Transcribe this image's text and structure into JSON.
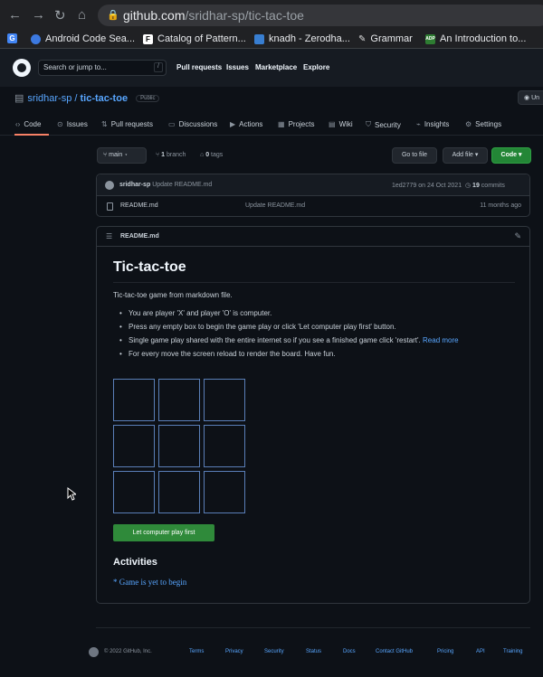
{
  "browser": {
    "url_host": "github.com",
    "url_path": "/sridhar-sp/tic-tac-toe",
    "bookmarks": [
      {
        "label": "Android Code Sea...",
        "icon": "android-icon",
        "color": "#3c79e0"
      },
      {
        "label": "Catalog of Pattern...",
        "icon": "f-icon",
        "color": "#ffffff"
      },
      {
        "label": "knadh - Zerodha...",
        "icon": "zerodha-icon",
        "color": "#387ed1"
      },
      {
        "label": "Grammar",
        "icon": "pen-icon",
        "color": "#dddddd"
      },
      {
        "label": "An Introduction to...",
        "icon": "adp-icon",
        "color": "#2e7d32"
      }
    ]
  },
  "header": {
    "search_placeholder": "Search or jump to...",
    "search_shortcut": "/",
    "nav": [
      "Pull requests",
      "Issues",
      "Marketplace",
      "Explore"
    ]
  },
  "repo": {
    "owner": "sridhar-sp",
    "separator": "/",
    "name": "tic-tac-toe",
    "visibility": "Public",
    "watch_label": "Un"
  },
  "tabs": [
    {
      "label": "Code",
      "icon": "code-icon"
    },
    {
      "label": "Issues",
      "icon": "issue-icon"
    },
    {
      "label": "Pull requests",
      "icon": "pull-request-icon"
    },
    {
      "label": "Discussions",
      "icon": "discussion-icon"
    },
    {
      "label": "Actions",
      "icon": "play-icon"
    },
    {
      "label": "Projects",
      "icon": "table-icon"
    },
    {
      "label": "Wiki",
      "icon": "book-icon"
    },
    {
      "label": "Security",
      "icon": "shield-icon"
    },
    {
      "label": "Insights",
      "icon": "graph-icon"
    },
    {
      "label": "Settings",
      "icon": "gear-icon"
    }
  ],
  "toolbar": {
    "branch": "main",
    "branch_count": "1",
    "branch_word": "branch",
    "tag_count": "0",
    "tag_word": "tags",
    "go_to_file": "Go to file",
    "add_file": "Add file",
    "code": "Code"
  },
  "commit": {
    "author": "sridhar-sp",
    "message": "Update README.md",
    "sha": "1ed2779",
    "date": "on 24 Oct 2021",
    "count": "19",
    "count_word": "commits"
  },
  "files": [
    {
      "name": "README.md",
      "message": "Update README.md",
      "age": "11 months ago"
    }
  ],
  "readme": {
    "file_name": "README.md",
    "title": "Tic-tac-toe",
    "intro": "Tic-tac-toe game from markdown file.",
    "bullets": [
      "You are player 'X' and player 'O' is computer.",
      "Press any empty box to begin the game play or click 'Let computer play first' button.",
      "Single game play shared with the entire internet so if you see a finished game click 'restart'.",
      "For every move the screen reload to render the board. Have fun."
    ],
    "read_more": "Read more",
    "board": [
      "",
      "",
      "",
      "",
      "",
      "",
      "",
      "",
      ""
    ],
    "play_button": "Let computer play first",
    "activities_heading": "Activities",
    "activity": "* Game is yet to begin"
  },
  "footer": {
    "copyright": "© 2022 GitHub, Inc.",
    "links": [
      "Terms",
      "Privacy",
      "Security",
      "Status",
      "Docs",
      "Contact GitHub",
      "Pricing",
      "API",
      "Training"
    ]
  }
}
